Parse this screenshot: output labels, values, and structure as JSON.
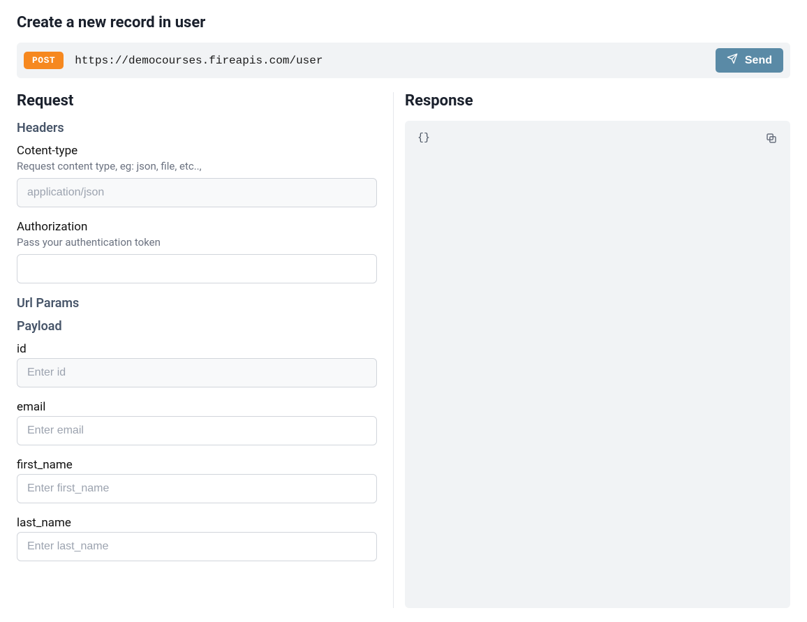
{
  "title": "Create a new record in user",
  "endpoint": {
    "method": "POST",
    "url": "https://democourses.fireapis.com/user",
    "send_label": "Send"
  },
  "request": {
    "title": "Request",
    "headers": {
      "title": "Headers",
      "content_type": {
        "label": "Cotent-type",
        "hint": "Request content type, eg: json, file, etc..,",
        "placeholder": "application/json",
        "value": ""
      },
      "authorization": {
        "label": "Authorization",
        "hint": "Pass your authentication token",
        "value": ""
      }
    },
    "url_params": {
      "title": "Url Params"
    },
    "payload": {
      "title": "Payload",
      "fields": {
        "id": {
          "label": "id",
          "placeholder": "Enter id",
          "value": ""
        },
        "email": {
          "label": "email",
          "placeholder": "Enter email",
          "value": ""
        },
        "first_name": {
          "label": "first_name",
          "placeholder": "Enter first_name",
          "value": ""
        },
        "last_name": {
          "label": "last_name",
          "placeholder": "Enter last_name",
          "value": ""
        }
      }
    }
  },
  "response": {
    "title": "Response",
    "body": "{}"
  }
}
